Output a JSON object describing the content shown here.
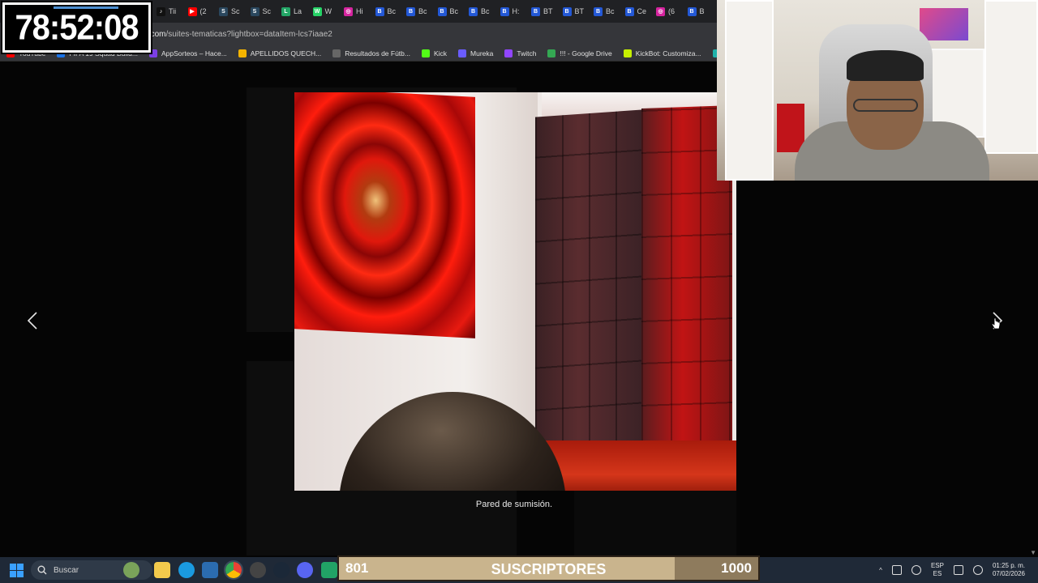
{
  "timer": {
    "value": "78:52:08"
  },
  "browser": {
    "tabs": [
      {
        "icon": "tiktok-icon",
        "label": "Tii",
        "color": "#111111",
        "glyph": "♪"
      },
      {
        "icon": "youtube-icon",
        "label": "(2",
        "color": "#ff0000",
        "glyph": "▶"
      },
      {
        "icon": "steam-icon",
        "label": "Sc",
        "color": "#2a475e",
        "glyph": "S"
      },
      {
        "icon": "steam-icon",
        "label": "Sc",
        "color": "#2a475e",
        "glyph": "S"
      },
      {
        "icon": "sheets-icon",
        "label": "La",
        "color": "#23a566",
        "glyph": "L"
      },
      {
        "icon": "whatsapp-icon",
        "label": "W",
        "color": "#25d366",
        "glyph": "W"
      },
      {
        "icon": "instagram-icon",
        "label": "Hi",
        "color": "#d6249f",
        "glyph": "◎"
      },
      {
        "icon": "booking-icon",
        "label": "Bc",
        "color": "#2358d6",
        "glyph": "B"
      },
      {
        "icon": "booking-icon",
        "label": "Bc",
        "color": "#2358d6",
        "glyph": "B"
      },
      {
        "icon": "booking-icon",
        "label": "Bc",
        "color": "#2358d6",
        "glyph": "B"
      },
      {
        "icon": "booking-icon",
        "label": "Bc",
        "color": "#2358d6",
        "glyph": "B"
      },
      {
        "icon": "booking-icon",
        "label": "H:",
        "color": "#2358d6",
        "glyph": "B"
      },
      {
        "icon": "booking-icon",
        "label": "BT",
        "color": "#2358d6",
        "glyph": "B"
      },
      {
        "icon": "booking-icon",
        "label": "BT",
        "color": "#2358d6",
        "glyph": "B"
      },
      {
        "icon": "booking-icon",
        "label": "Bc",
        "color": "#2358d6",
        "glyph": "B"
      },
      {
        "icon": "booking-icon",
        "label": "Ce",
        "color": "#2358d6",
        "glyph": "B"
      },
      {
        "icon": "instagram-icon",
        "label": "(6",
        "color": "#d6249f",
        "glyph": "◎"
      },
      {
        "icon": "booking-icon",
        "label": "B",
        "color": "#2358d6",
        "glyph": "B"
      }
    ],
    "url_prefix": "",
    "url_domain": "...eru.com",
    "url_path": "/suites-tematicas?lightbox=dataItem-lcs7iaae2",
    "bookmarks": [
      {
        "icon": "youtube-icon",
        "label": "YouTube",
        "color": "#ff0000"
      },
      {
        "icon": "futbin-icon",
        "label": "FIFA 19 Squad Build...",
        "color": "#1a73e8"
      },
      {
        "icon": "appsorteos-icon",
        "label": "AppSorteos – Hace...",
        "color": "#7b3fe4"
      },
      {
        "icon": "chrome-icon",
        "label": "APELLIDOS QUECH...",
        "color": "#f4b400"
      },
      {
        "icon": "espn-icon",
        "label": "Resultados de Fútb...",
        "color": "#666666"
      },
      {
        "icon": "kick-icon",
        "label": "Kick",
        "color": "#53fc18"
      },
      {
        "icon": "mureka-icon",
        "label": "Mureka",
        "color": "#6a5cff"
      },
      {
        "icon": "twitch-icon",
        "label": "Twitch",
        "color": "#9146ff"
      },
      {
        "icon": "drive-icon",
        "label": "!!! - Google Drive",
        "color": "#34a853"
      },
      {
        "icon": "kickbot-icon",
        "label": "KickBot: Customiza...",
        "color": "#c6f000"
      },
      {
        "icon": "ea-icon",
        "label": "EA FC 26",
        "color": "#1fb2aa"
      }
    ]
  },
  "lightbox": {
    "caption": "Pared de sumisión.",
    "prev_label": "Previous",
    "next_label": "Next",
    "photo_alt": "Suite room photo"
  },
  "taskbar": {
    "search_placeholder": "Buscar",
    "lang_top": "ESP",
    "lang_bottom": "ES",
    "time": "01:25 p. m.",
    "date": "07/02/2026"
  },
  "subscribers": {
    "current": "801",
    "label": "SUSCRIPTORES",
    "goal": "1000",
    "progress_fraction": 0.801
  }
}
